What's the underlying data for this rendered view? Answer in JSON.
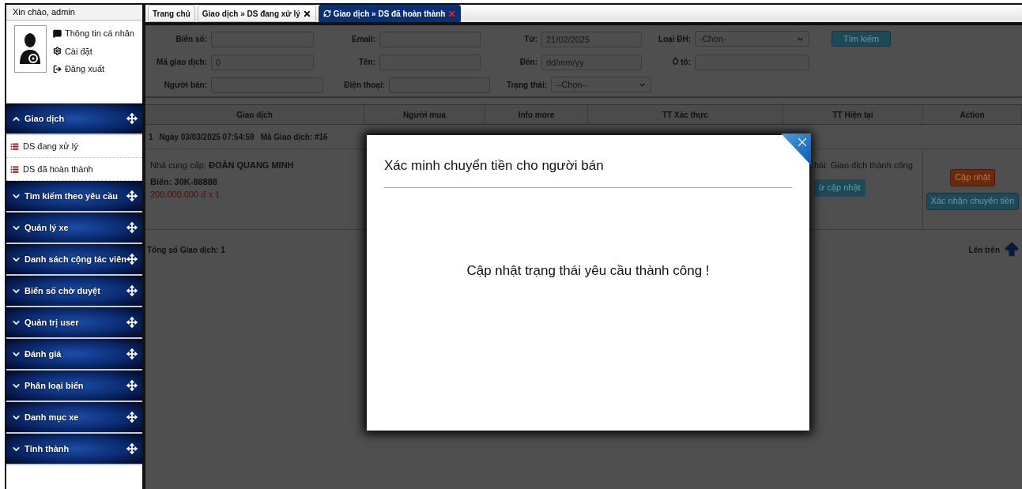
{
  "sidebar": {
    "greeting": "Xin chào, admin",
    "profile_links": [
      {
        "label": "Thông tin cá nhân"
      },
      {
        "label": "Cài đặt"
      },
      {
        "label": "Đăng xuất"
      }
    ],
    "menu": [
      {
        "label": "Giao dịch",
        "expanded": true,
        "children": [
          {
            "label": "DS đang xử lý"
          },
          {
            "label": "DS đã hoàn thành"
          }
        ]
      },
      {
        "label": "Tìm kiếm theo yêu cầu",
        "expanded": false
      },
      {
        "label": "Quản lý xe",
        "expanded": false
      },
      {
        "label": "Danh sách cộng tác viên",
        "expanded": false
      },
      {
        "label": "Biển số chờ duyệt",
        "expanded": false
      },
      {
        "label": "Quản trị user",
        "expanded": false
      },
      {
        "label": "Đánh giá",
        "expanded": false
      },
      {
        "label": "Phân loại biển",
        "expanded": false
      },
      {
        "label": "Danh mục xe",
        "expanded": false
      },
      {
        "label": "Tỉnh thành",
        "expanded": false
      }
    ]
  },
  "tabs": [
    {
      "label": "Trang chủ",
      "selected": false,
      "closable": false
    },
    {
      "label": "Giao dịch » DS đang xử lý",
      "selected": false,
      "closable": true
    },
    {
      "label": "Giao dịch » DS đã hoàn thành",
      "selected": true,
      "closable": true
    }
  ],
  "search_form": {
    "rows": [
      [
        {
          "label": "Biển số:",
          "kind": "text"
        },
        {
          "label": "Email:",
          "kind": "text"
        },
        {
          "label": "Từ:",
          "kind": "text",
          "value": "21/02/2025"
        },
        {
          "label": "Loại ĐH:",
          "kind": "select",
          "value": "-Chọn-"
        }
      ],
      [
        {
          "label": "Mã giao dịch:",
          "kind": "text",
          "value": "0"
        },
        {
          "label": "Tên:",
          "kind": "text"
        },
        {
          "label": "Đến:",
          "kind": "text",
          "placeholder": "dd/mm/yy"
        },
        {
          "label": "Ô tô:",
          "kind": "text"
        }
      ],
      [
        {
          "label": "Người bán:",
          "kind": "text"
        },
        {
          "label": "Điện thoại:",
          "kind": "text"
        },
        {
          "label": "Trạng thái:",
          "kind": "select",
          "value": "--Chọn--"
        }
      ]
    ],
    "search_button": "Tìm kiếm"
  },
  "table": {
    "columns": [
      "Giao dịch",
      "Người mua",
      "Info more",
      "TT Xác thực",
      "TT Hiện tại",
      "Action"
    ],
    "groups": [
      {
        "index": "1",
        "date": "Ngày 03/03/2025 07:54:59",
        "code": "Mã Giao dịch: #16",
        "supplier": "Nhà cung cấp: **ĐOÀN QUANG MINH**",
        "plate": "Biển: 30K-88888",
        "price": "200.000.000 đ x 1",
        "status": "hái: Giao dịch thành công",
        "status_button": "ừ cập nhật",
        "actions": [
          {
            "label": "Cập nhật",
            "kind": "update"
          },
          {
            "label": "Xác nhận chuyển tiền",
            "kind": "confirm"
          }
        ]
      }
    ],
    "total": "Tổng số Giao dịch: 1",
    "to_top": "Lên trên"
  },
  "modal": {
    "title": "Xác minh chuyển tiền cho người bán",
    "message": "Cập nhật trạng thái yêu cầu thành công !"
  }
}
